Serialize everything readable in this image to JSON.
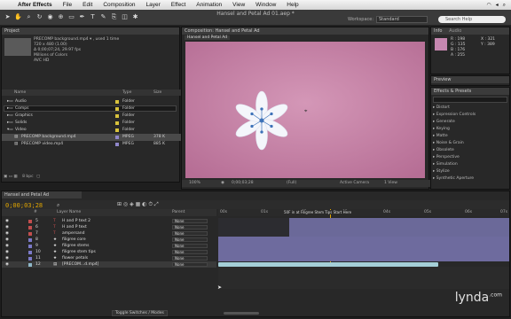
{
  "menubar": {
    "app": "After Effects",
    "items": [
      "File",
      "Edit",
      "Composition",
      "Layer",
      "Effect",
      "Animation",
      "View",
      "Window",
      "Help"
    ]
  },
  "toolbar": {
    "doc_title": "Hansel and Petal Ad 01.aep *",
    "workspace_label": "Workspace:",
    "workspace_value": "Standard",
    "search_placeholder": "Search Help"
  },
  "project": {
    "tab": "Project",
    "selected_name": "PRECOMP background.mp4 ▾ , used 1 time",
    "info_lines": [
      "720 x 480 (1.00)",
      "Δ 0;00;07;24, 29.97 fps",
      "Millions of Colors",
      "AVC HD"
    ],
    "columns": [
      "Name",
      "Type",
      "Size"
    ],
    "rows": [
      {
        "name": "Audio",
        "type": "Folder",
        "size": ""
      },
      {
        "name": "Comps",
        "type": "Folder",
        "size": ""
      },
      {
        "name": "Graphics",
        "type": "Folder",
        "size": ""
      },
      {
        "name": "Solids",
        "type": "Folder",
        "size": ""
      },
      {
        "name": "Video",
        "type": "Folder",
        "size": ""
      },
      {
        "name": "PRECOMP background.mp4",
        "type": "MPEG",
        "size": "378 K"
      },
      {
        "name": "PRECOMP video.mp4",
        "type": "MPEG",
        "size": "885 K"
      }
    ],
    "bpc": "8 bpc"
  },
  "composition": {
    "tab": "Composition: Hansel and Petal Ad",
    "sub_tab": "Hansel and Petal Ad",
    "zoom": "100%",
    "timecode": "0;00;03;28",
    "resolution": "(Full)",
    "camera": "Active Camera",
    "view": "1 View"
  },
  "info": {
    "tab": "Info",
    "audio_tab": "Audio",
    "values": [
      "R : 198",
      "G : 135",
      "B : 176",
      "A : 255",
      "X : 321",
      "Y : 389"
    ]
  },
  "preview": {
    "tab": "Preview"
  },
  "effects": {
    "tab": "Effects & Presets",
    "categories": [
      "Distort",
      "Expression Controls",
      "Generate",
      "Keying",
      "Matte",
      "Noise & Grain",
      "Obsolete",
      "Perspective",
      "Simulation",
      "Stylize",
      "Synthetic Aperture"
    ]
  },
  "timeline": {
    "tab": "Hansel and Petal Ad",
    "timecode": "0;00;03;28",
    "columns": [
      "#",
      "Layer Name",
      "Parent"
    ],
    "layers": [
      {
        "num": "5",
        "name": "H and P text 2",
        "parent": "None"
      },
      {
        "num": "6",
        "name": "H and P text",
        "parent": "None"
      },
      {
        "num": "7",
        "name": "ampersand",
        "parent": "None"
      },
      {
        "num": "8",
        "name": "filigree core",
        "parent": "None"
      },
      {
        "num": "9",
        "name": "filigree stems",
        "parent": "None"
      },
      {
        "num": "10",
        "name": "filigree stem tips",
        "parent": "None"
      },
      {
        "num": "11",
        "name": "flower petals",
        "parent": "None"
      },
      {
        "num": "12",
        "name": "[PRECOM...d.mp4]",
        "parent": "None"
      }
    ],
    "ruler": [
      "00s",
      "01s",
      "02s",
      "03s",
      "04s",
      "05s",
      "06s",
      "07s"
    ],
    "marker_text": "50F in at Filigree Stem Tips Start Here",
    "toggle_label": "Toggle Switches / Modes"
  },
  "watermark": "lynda",
  "watermark_suffix": ".com"
}
